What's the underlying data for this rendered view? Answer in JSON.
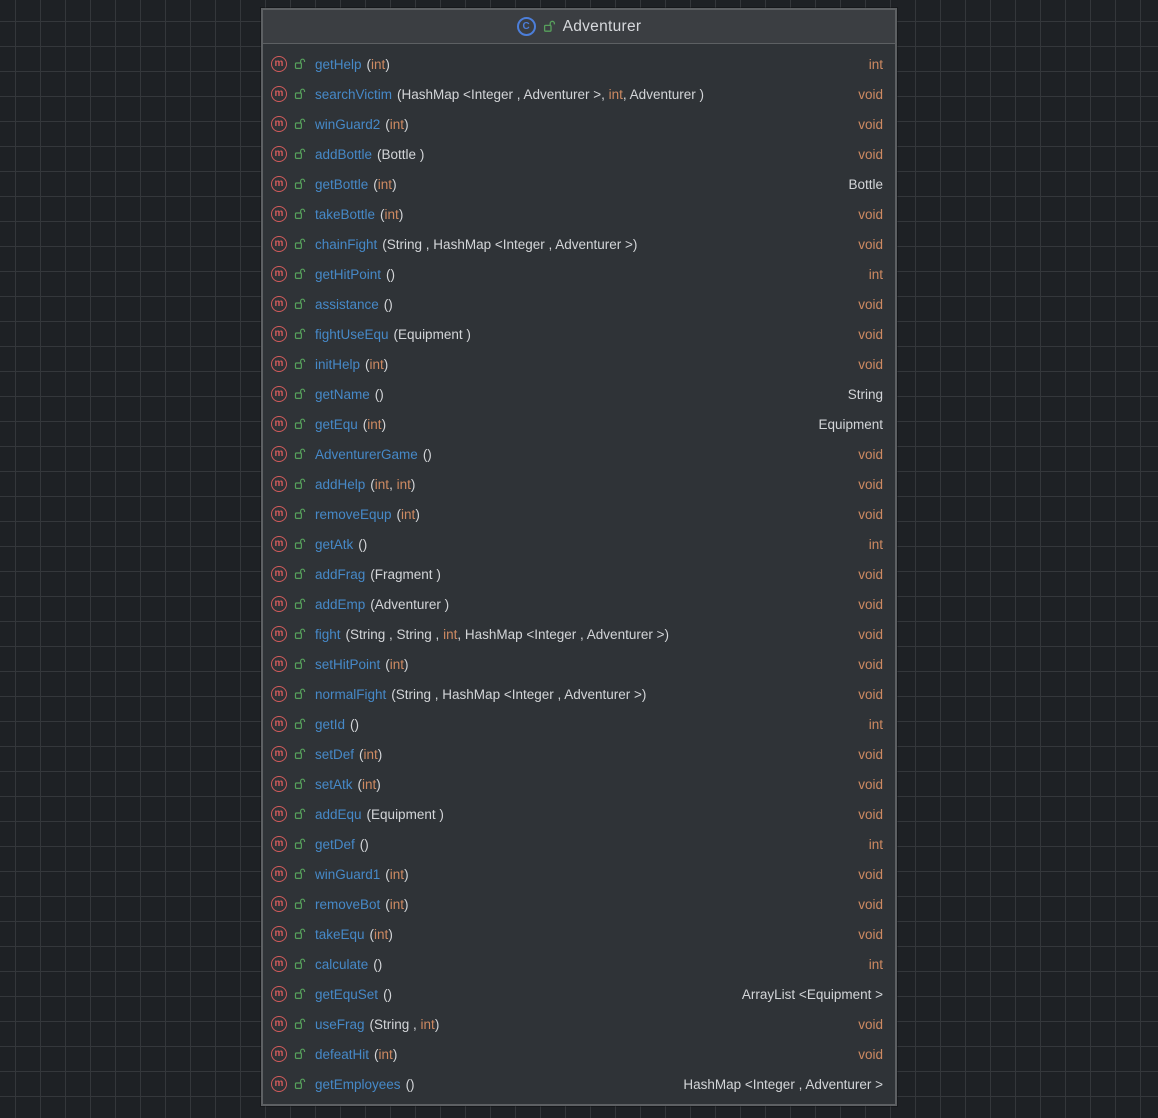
{
  "colors": {
    "canvas_background": "#1e2125",
    "grid_line": "#34373b",
    "panel_background": "#2f3337",
    "panel_header_background": "#3b3e42",
    "panel_border": "#5d6063",
    "method_name_blue": "#4689c8",
    "keyword_orange": "#ce8a62",
    "type_gray": "#d3d5d8",
    "method_icon_red": "#d25b5b",
    "class_icon_blue": "#4c7ed9",
    "public_lock_green": "#57a05c",
    "title_text": "#d7d9dd"
  },
  "icons": {
    "class_icon": "circled-letter-C",
    "method_icon": "circled-letter-m",
    "visibility_icon": "open-padlock-public",
    "class_icon_letter": "C",
    "method_icon_letter": "m"
  },
  "class_box": {
    "title": "Adventurer",
    "methods": [
      {
        "name": "getHelp",
        "params": [
          {
            "t": "(",
            "k": "pl"
          },
          {
            "t": "int",
            "k": "kw"
          },
          {
            "t": ")",
            "k": "pl"
          }
        ],
        "ret": "int",
        "ret_kind": "kw"
      },
      {
        "name": "searchVictim",
        "params": [
          {
            "t": "(HashMap <Integer , Adventurer >, ",
            "k": "pl"
          },
          {
            "t": "int",
            "k": "kw"
          },
          {
            "t": ", Adventurer )",
            "k": "pl"
          }
        ],
        "ret": "void",
        "ret_kind": "kw"
      },
      {
        "name": "winGuard2",
        "params": [
          {
            "t": "(",
            "k": "pl"
          },
          {
            "t": "int",
            "k": "kw"
          },
          {
            "t": ")",
            "k": "pl"
          }
        ],
        "ret": "void",
        "ret_kind": "kw"
      },
      {
        "name": "addBottle",
        "params": [
          {
            "t": "(Bottle )",
            "k": "pl"
          }
        ],
        "ret": "void",
        "ret_kind": "kw"
      },
      {
        "name": "getBottle",
        "params": [
          {
            "t": "(",
            "k": "pl"
          },
          {
            "t": "int",
            "k": "kw"
          },
          {
            "t": ")",
            "k": "pl"
          }
        ],
        "ret": "Bottle",
        "ret_kind": "pl"
      },
      {
        "name": "takeBottle",
        "params": [
          {
            "t": "(",
            "k": "pl"
          },
          {
            "t": "int",
            "k": "kw"
          },
          {
            "t": ")",
            "k": "pl"
          }
        ],
        "ret": "void",
        "ret_kind": "kw"
      },
      {
        "name": "chainFight",
        "params": [
          {
            "t": "(String , HashMap <Integer , Adventurer >)",
            "k": "pl"
          }
        ],
        "ret": "void",
        "ret_kind": "kw"
      },
      {
        "name": "getHitPoint",
        "params": [
          {
            "t": "()",
            "k": "pl"
          }
        ],
        "ret": "int",
        "ret_kind": "kw"
      },
      {
        "name": "assistance",
        "params": [
          {
            "t": "()",
            "k": "pl"
          }
        ],
        "ret": "void",
        "ret_kind": "kw"
      },
      {
        "name": "fightUseEqu",
        "params": [
          {
            "t": "(Equipment )",
            "k": "pl"
          }
        ],
        "ret": "void",
        "ret_kind": "kw"
      },
      {
        "name": "initHelp",
        "params": [
          {
            "t": "(",
            "k": "pl"
          },
          {
            "t": "int",
            "k": "kw"
          },
          {
            "t": ")",
            "k": "pl"
          }
        ],
        "ret": "void",
        "ret_kind": "kw"
      },
      {
        "name": "getName",
        "params": [
          {
            "t": "()",
            "k": "pl"
          }
        ],
        "ret": "String",
        "ret_kind": "pl"
      },
      {
        "name": "getEqu",
        "params": [
          {
            "t": "(",
            "k": "pl"
          },
          {
            "t": "int",
            "k": "kw"
          },
          {
            "t": ")",
            "k": "pl"
          }
        ],
        "ret": "Equipment",
        "ret_kind": "pl"
      },
      {
        "name": "AdventurerGame",
        "params": [
          {
            "t": "()",
            "k": "pl"
          }
        ],
        "ret": "void",
        "ret_kind": "kw"
      },
      {
        "name": "addHelp",
        "params": [
          {
            "t": "(",
            "k": "pl"
          },
          {
            "t": "int",
            "k": "kw"
          },
          {
            "t": ", ",
            "k": "pl"
          },
          {
            "t": "int",
            "k": "kw"
          },
          {
            "t": ")",
            "k": "pl"
          }
        ],
        "ret": "void",
        "ret_kind": "kw"
      },
      {
        "name": "removeEqup",
        "params": [
          {
            "t": "(",
            "k": "pl"
          },
          {
            "t": "int",
            "k": "kw"
          },
          {
            "t": ")",
            "k": "pl"
          }
        ],
        "ret": "void",
        "ret_kind": "kw"
      },
      {
        "name": "getAtk",
        "params": [
          {
            "t": "()",
            "k": "pl"
          }
        ],
        "ret": "int",
        "ret_kind": "kw"
      },
      {
        "name": "addFrag",
        "params": [
          {
            "t": "(Fragment )",
            "k": "pl"
          }
        ],
        "ret": "void",
        "ret_kind": "kw"
      },
      {
        "name": "addEmp",
        "params": [
          {
            "t": "(Adventurer )",
            "k": "pl"
          }
        ],
        "ret": "void",
        "ret_kind": "kw"
      },
      {
        "name": "fight",
        "params": [
          {
            "t": "(String , String , ",
            "k": "pl"
          },
          {
            "t": "int",
            "k": "kw"
          },
          {
            "t": ", HashMap <Integer , Adventurer >)",
            "k": "pl"
          }
        ],
        "ret": "void",
        "ret_kind": "kw"
      },
      {
        "name": "setHitPoint",
        "params": [
          {
            "t": "(",
            "k": "pl"
          },
          {
            "t": "int",
            "k": "kw"
          },
          {
            "t": ")",
            "k": "pl"
          }
        ],
        "ret": "void",
        "ret_kind": "kw"
      },
      {
        "name": "normalFight",
        "params": [
          {
            "t": "(String , HashMap <Integer , Adventurer >)",
            "k": "pl"
          }
        ],
        "ret": "void",
        "ret_kind": "kw"
      },
      {
        "name": "getId",
        "params": [
          {
            "t": "()",
            "k": "pl"
          }
        ],
        "ret": "int",
        "ret_kind": "kw"
      },
      {
        "name": "setDef",
        "params": [
          {
            "t": "(",
            "k": "pl"
          },
          {
            "t": "int",
            "k": "kw"
          },
          {
            "t": ")",
            "k": "pl"
          }
        ],
        "ret": "void",
        "ret_kind": "kw"
      },
      {
        "name": "setAtk",
        "params": [
          {
            "t": "(",
            "k": "pl"
          },
          {
            "t": "int",
            "k": "kw"
          },
          {
            "t": ")",
            "k": "pl"
          }
        ],
        "ret": "void",
        "ret_kind": "kw"
      },
      {
        "name": "addEqu",
        "params": [
          {
            "t": "(Equipment )",
            "k": "pl"
          }
        ],
        "ret": "void",
        "ret_kind": "kw"
      },
      {
        "name": "getDef",
        "params": [
          {
            "t": "()",
            "k": "pl"
          }
        ],
        "ret": "int",
        "ret_kind": "kw"
      },
      {
        "name": "winGuard1",
        "params": [
          {
            "t": "(",
            "k": "pl"
          },
          {
            "t": "int",
            "k": "kw"
          },
          {
            "t": ")",
            "k": "pl"
          }
        ],
        "ret": "void",
        "ret_kind": "kw"
      },
      {
        "name": "removeBot",
        "params": [
          {
            "t": "(",
            "k": "pl"
          },
          {
            "t": "int",
            "k": "kw"
          },
          {
            "t": ")",
            "k": "pl"
          }
        ],
        "ret": "void",
        "ret_kind": "kw"
      },
      {
        "name": "takeEqu",
        "params": [
          {
            "t": "(",
            "k": "pl"
          },
          {
            "t": "int",
            "k": "kw"
          },
          {
            "t": ")",
            "k": "pl"
          }
        ],
        "ret": "void",
        "ret_kind": "kw"
      },
      {
        "name": "calculate",
        "params": [
          {
            "t": "()",
            "k": "pl"
          }
        ],
        "ret": "int",
        "ret_kind": "kw"
      },
      {
        "name": "getEquSet",
        "params": [
          {
            "t": "()",
            "k": "pl"
          }
        ],
        "ret": "ArrayList <Equipment >",
        "ret_kind": "pl"
      },
      {
        "name": "useFrag",
        "params": [
          {
            "t": "(String , ",
            "k": "pl"
          },
          {
            "t": "int",
            "k": "kw"
          },
          {
            "t": ")",
            "k": "pl"
          }
        ],
        "ret": "void",
        "ret_kind": "kw"
      },
      {
        "name": "defeatHit",
        "params": [
          {
            "t": "(",
            "k": "pl"
          },
          {
            "t": "int",
            "k": "kw"
          },
          {
            "t": ")",
            "k": "pl"
          }
        ],
        "ret": "void",
        "ret_kind": "kw"
      },
      {
        "name": "getEmployees",
        "params": [
          {
            "t": "()",
            "k": "pl"
          }
        ],
        "ret": "HashMap <Integer , Adventurer >",
        "ret_kind": "pl"
      }
    ]
  }
}
